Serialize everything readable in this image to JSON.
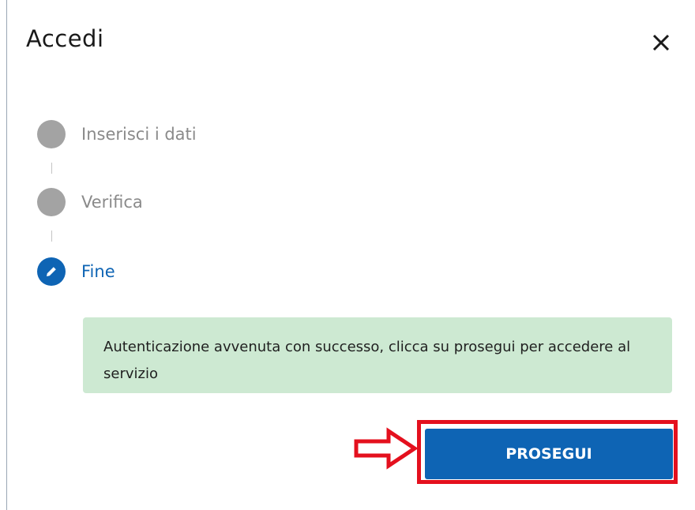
{
  "dialog": {
    "title": "Accedi",
    "close_icon": "close-icon"
  },
  "steps": [
    {
      "label": "Inserisci i dati",
      "state": "completed"
    },
    {
      "label": "Verifica",
      "state": "completed"
    },
    {
      "label": "Fine",
      "state": "active",
      "icon": "pencil-icon"
    }
  ],
  "alert": {
    "message": "Autenticazione avvenuta con successo, clicca su prosegui per accedere al servizio",
    "background_color": "#cde9d2"
  },
  "actions": {
    "continue_label": "PROSEGUI",
    "button_color": "#0e64b4"
  },
  "annotation": {
    "arrow_icon": "right-arrow-icon",
    "highlight_color": "#e4101e"
  },
  "colors": {
    "accent": "#0e64b4",
    "step_inactive": "#a3a3a3"
  }
}
